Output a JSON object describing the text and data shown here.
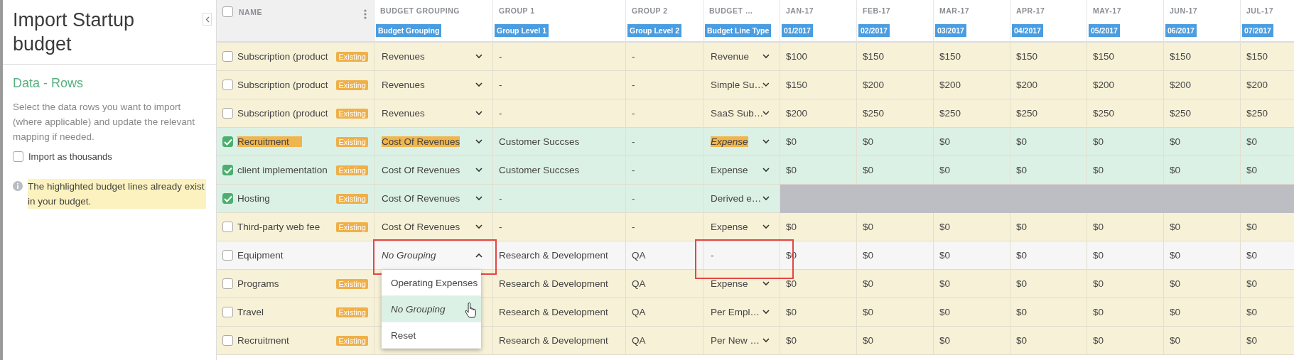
{
  "sidebar": {
    "title": "Import Startup budget",
    "section_title": "Data - Rows",
    "description": "Select the data rows you want to import (where applicable) and update the relevant mapping if needed.",
    "thousands": {
      "label": "Import as thousands",
      "checked": false
    },
    "note": "The highlighted budget lines already exist in your budget."
  },
  "table": {
    "select_all_checked": false,
    "columns": [
      {
        "label": "NAME"
      },
      {
        "label": "BUDGET GROUPING",
        "mapping": "Budget Grouping"
      },
      {
        "label": "GROUP 1",
        "mapping": "Group Level 1"
      },
      {
        "label": "GROUP 2",
        "mapping": "Group Level 2"
      },
      {
        "label": "BUDGET …",
        "mapping": "Budget Line Type"
      },
      {
        "label": "JAN-17",
        "mapping": "01/2017"
      },
      {
        "label": "FEB-17",
        "mapping": "02/2017"
      },
      {
        "label": "MAR-17",
        "mapping": "03/2017"
      },
      {
        "label": "APR-17",
        "mapping": "04/2017"
      },
      {
        "label": "MAY-17",
        "mapping": "05/2017"
      },
      {
        "label": "JUN-17",
        "mapping": "06/2017"
      },
      {
        "label": "JUL-17",
        "mapping": "07/2017"
      }
    ],
    "rows": [
      {
        "checked": false,
        "name": "Subscription (product",
        "highlighted": false,
        "badge": "Existing",
        "grouping": {
          "value": "Revenues",
          "highlighted": false,
          "italic": false,
          "open": false,
          "annotated": false
        },
        "group_1": "-",
        "group_2": "-",
        "line_type": {
          "value": "Revenue",
          "dropdown": true,
          "highlighted": false,
          "italic": false,
          "annotated": false
        },
        "blocked": false,
        "months": [
          "$100",
          "$150",
          "$150",
          "$150",
          "$150",
          "$150",
          "$150"
        ]
      },
      {
        "checked": false,
        "name": "Subscription (product",
        "highlighted": false,
        "badge": "Existing",
        "grouping": {
          "value": "Revenues",
          "highlighted": false,
          "italic": false,
          "open": false,
          "annotated": false
        },
        "group_1": "-",
        "group_2": "-",
        "line_type": {
          "value": "Simple Su…",
          "dropdown": true,
          "highlighted": false,
          "italic": false,
          "annotated": false
        },
        "blocked": false,
        "months": [
          "$150",
          "$200",
          "$200",
          "$200",
          "$200",
          "$200",
          "$200"
        ]
      },
      {
        "checked": false,
        "name": "Subscription (product",
        "highlighted": false,
        "badge": "Existing",
        "grouping": {
          "value": "Revenues",
          "highlighted": false,
          "italic": false,
          "open": false,
          "annotated": false
        },
        "group_1": "-",
        "group_2": "-",
        "line_type": {
          "value": "SaaS Sub…",
          "dropdown": true,
          "highlighted": false,
          "italic": false,
          "annotated": false
        },
        "blocked": false,
        "months": [
          "$200",
          "$250",
          "$250",
          "$250",
          "$250",
          "$250",
          "$250"
        ]
      },
      {
        "checked": true,
        "name": "Recruitment",
        "highlighted": true,
        "badge": "Existing",
        "grouping": {
          "value": "Cost Of Revenues",
          "highlighted": true,
          "italic": false,
          "open": false,
          "annotated": false
        },
        "group_1": "Customer Succses",
        "group_2": "-",
        "line_type": {
          "value": "Expense",
          "dropdown": true,
          "highlighted": true,
          "italic": true,
          "annotated": false
        },
        "blocked": false,
        "months": [
          "$0",
          "$0",
          "$0",
          "$0",
          "$0",
          "$0",
          "$0"
        ]
      },
      {
        "checked": true,
        "name": "client implementation",
        "highlighted": false,
        "badge": "Existing",
        "grouping": {
          "value": "Cost Of Revenues",
          "highlighted": false,
          "italic": false,
          "open": false,
          "annotated": false
        },
        "group_1": "Customer Succses",
        "group_2": "-",
        "line_type": {
          "value": "Expense",
          "dropdown": true,
          "highlighted": false,
          "italic": false,
          "annotated": false
        },
        "blocked": false,
        "months": [
          "$0",
          "$0",
          "$0",
          "$0",
          "$0",
          "$0",
          "$0"
        ]
      },
      {
        "checked": true,
        "name": "Hosting",
        "highlighted": false,
        "badge": "Existing",
        "grouping": {
          "value": "Cost Of Revenues",
          "highlighted": false,
          "italic": false,
          "open": false,
          "annotated": false
        },
        "group_1": "-",
        "group_2": "-",
        "line_type": {
          "value": "Derived e…",
          "dropdown": true,
          "highlighted": false,
          "italic": false,
          "annotated": false
        },
        "blocked": true
      },
      {
        "checked": false,
        "name": "Third-party web fee",
        "highlighted": false,
        "badge": "Existing",
        "grouping": {
          "value": "Cost Of Revenues",
          "highlighted": false,
          "italic": false,
          "open": false,
          "annotated": false
        },
        "group_1": "-",
        "group_2": "-",
        "line_type": {
          "value": "Expense",
          "dropdown": true,
          "highlighted": false,
          "italic": false,
          "annotated": false
        },
        "blocked": false,
        "months": [
          "$0",
          "$0",
          "$0",
          "$0",
          "$0",
          "$0",
          "$0"
        ]
      },
      {
        "checked": false,
        "name": "Equipment",
        "highlighted": false,
        "grouping": {
          "value": "No Grouping",
          "highlighted": false,
          "italic": true,
          "open": true,
          "annotated": true,
          "menu": [
            {
              "label": "Operating Expenses",
              "selected": false,
              "italic": false
            },
            {
              "label": "No Grouping",
              "selected": true,
              "italic": true
            },
            {
              "label": "Reset",
              "selected": false,
              "italic": false
            }
          ]
        },
        "group_1": "Research & Development",
        "group_2": "QA",
        "line_type": {
          "value": "-",
          "dropdown": false,
          "highlighted": false,
          "italic": false,
          "annotated": true
        },
        "blocked": false,
        "months": [
          "$0",
          "$0",
          "$0",
          "$0",
          "$0",
          "$0",
          "$0"
        ]
      },
      {
        "checked": false,
        "name": "Programs",
        "highlighted": false,
        "badge": "Existing",
        "group_1": "Research & Development",
        "group_2": "QA",
        "line_type": {
          "value": "Expense",
          "dropdown": true,
          "highlighted": false,
          "italic": false,
          "annotated": false
        },
        "blocked": false,
        "months": [
          "$0",
          "$0",
          "$0",
          "$0",
          "$0",
          "$0",
          "$0"
        ]
      },
      {
        "checked": false,
        "name": "Travel",
        "highlighted": false,
        "badge": "Existing",
        "group_1": "Research & Development",
        "group_2": "QA",
        "line_type": {
          "value": "Per Empl…",
          "dropdown": true,
          "highlighted": false,
          "italic": false,
          "annotated": false
        },
        "blocked": false,
        "months": [
          "$0",
          "$0",
          "$0",
          "$0",
          "$0",
          "$0",
          "$0"
        ]
      },
      {
        "checked": false,
        "name": "Recruitment",
        "highlighted": false,
        "badge": "Existing",
        "group_1": "Research & Development",
        "group_2": "QA",
        "line_type": {
          "value": "Per New …",
          "dropdown": true,
          "highlighted": false,
          "italic": false,
          "annotated": false
        },
        "blocked": false,
        "months": [
          "$0",
          "$0",
          "$0",
          "$0",
          "$0",
          "$0",
          "$0"
        ]
      }
    ]
  }
}
